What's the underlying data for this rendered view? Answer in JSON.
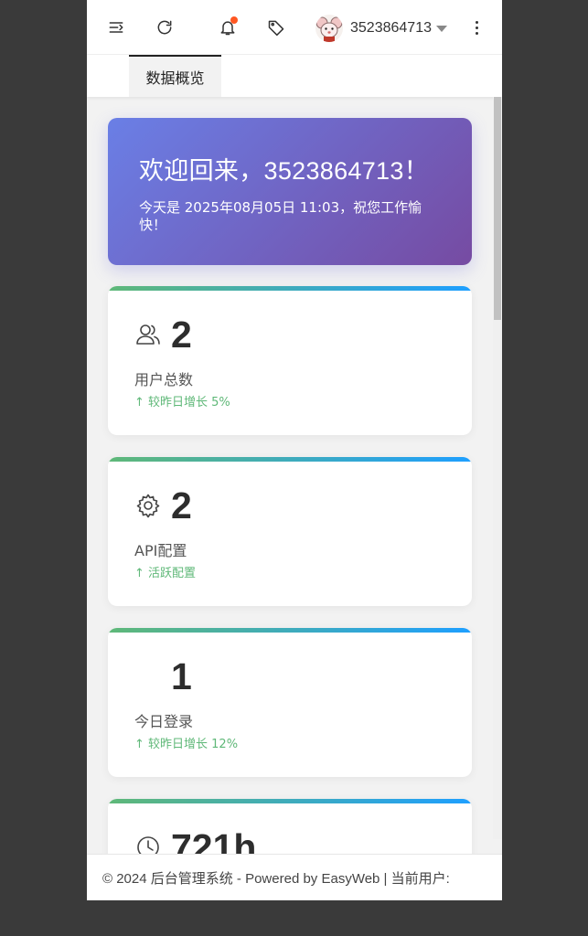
{
  "header": {
    "menu_icon": "menu-fold-icon",
    "refresh_icon": "refresh-icon",
    "notification_icon": "bell-icon",
    "tag_icon": "tag-icon",
    "username": "3523864713",
    "more_icon": "more-vertical-icon",
    "badge_color": "#ff5722"
  },
  "tabs": [
    {
      "label": "数据概览",
      "active": true
    }
  ],
  "welcome": {
    "title": "欢迎回来，3523864713！",
    "subtitle": "今天是 2025年08月05日 11:03，祝您工作愉快！",
    "gradient_start": "#6a7fe6",
    "gradient_end": "#764ba2"
  },
  "stats": [
    {
      "icon": "users-icon",
      "value": "2",
      "label": "用户总数",
      "trend": "↑ 较昨日增长 5%"
    },
    {
      "icon": "gear-icon",
      "value": "2",
      "label": "API配置",
      "trend": "↑ 活跃配置"
    },
    {
      "icon": "",
      "value": "1",
      "label": "今日登录",
      "trend": "↑ 较昨日增长 12%"
    },
    {
      "icon": "clock-icon",
      "value": "721h",
      "label": "",
      "trend": ""
    }
  ],
  "accent": {
    "green": "#5fb878",
    "blue": "#1e9fff"
  },
  "footer": {
    "text": "© 2024 后台管理系统 - Powered by EasyWeb | 当前用户:"
  }
}
